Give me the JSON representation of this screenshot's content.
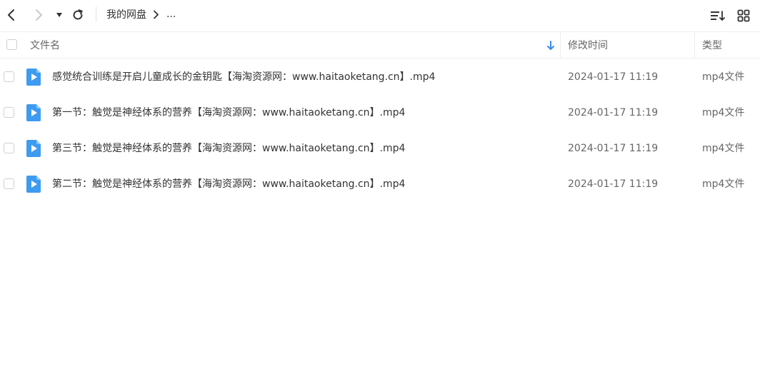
{
  "breadcrumb": {
    "root": "我的网盘",
    "more": "..."
  },
  "columns": {
    "name": "文件名",
    "modified": "修改时间",
    "type": "类型"
  },
  "files": [
    {
      "name": "感觉统合训练是开启儿童成长的金钥匙【海淘资源网：www.haitaoketang.cn】.mp4",
      "modified": "2024-01-17 11:19",
      "type": "mp4文件"
    },
    {
      "name": "第一节：触觉是神经体系的营养【海淘资源网：www.haitaoketang.cn】.mp4",
      "modified": "2024-01-17 11:19",
      "type": "mp4文件"
    },
    {
      "name": "第三节：触觉是神经体系的营养【海淘资源网：www.haitaoketang.cn】.mp4",
      "modified": "2024-01-17 11:19",
      "type": "mp4文件"
    },
    {
      "name": "第二节：触觉是神经体系的营养【海淘资源网：www.haitaoketang.cn】.mp4",
      "modified": "2024-01-17 11:19",
      "type": "mp4文件"
    }
  ],
  "icons": {
    "back": "chevron-left-icon",
    "forward": "chevron-right-icon",
    "dropdown": "caret-down-icon",
    "refresh": "refresh-icon",
    "sort": "sort-list-icon",
    "grid": "grid-view-icon",
    "file": "video-file-icon",
    "sort_direction": "arrow-down-icon"
  },
  "colors": {
    "accent": "#3a8ee6",
    "file_icon": "#3d9bf0",
    "disabled": "#c8c8c8"
  }
}
